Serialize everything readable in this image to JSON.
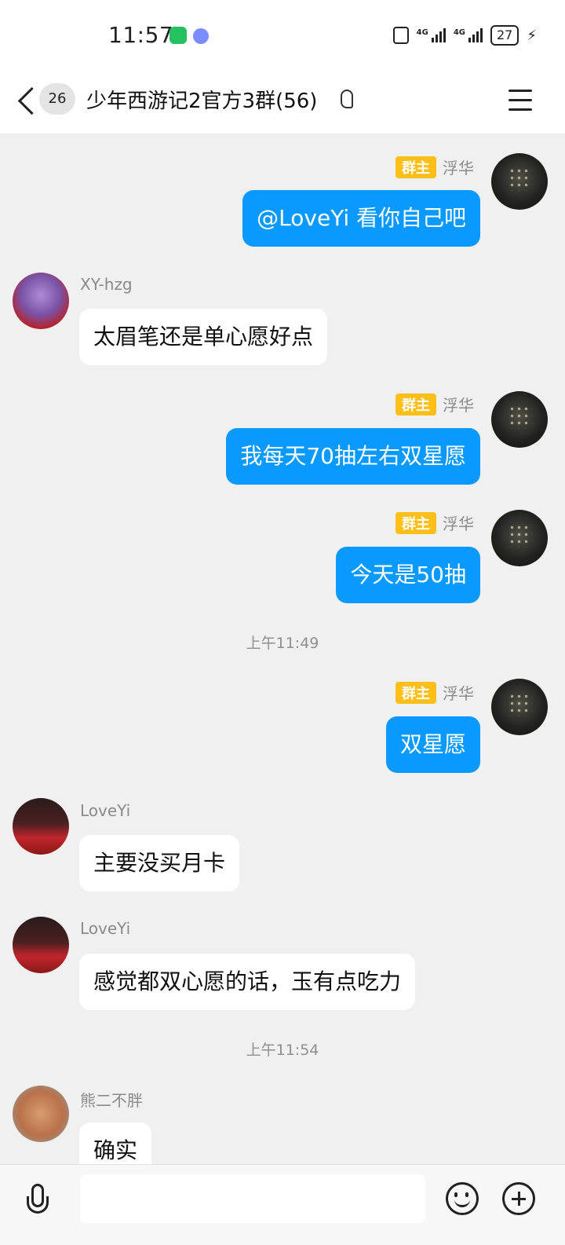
{
  "status_bar": {
    "time": "11:57",
    "network_1": "4G",
    "network_2": "4G",
    "battery": "27"
  },
  "header": {
    "unread_count": "26",
    "title": "少年西游记2官方3群(56)"
  },
  "messages": [
    {
      "sender": "浮华",
      "role": "群主",
      "text": "@LoveYi 看你自己吧",
      "outgoing": true
    },
    {
      "sender": "XY-hzg",
      "role": "",
      "text": "太眉笔还是单心愿好点",
      "outgoing": false
    },
    {
      "sender": "浮华",
      "role": "群主",
      "text": "我每天70抽左右双星愿",
      "outgoing": true
    },
    {
      "sender": "浮华",
      "role": "群主",
      "text": "今天是50抽",
      "outgoing": true
    },
    {
      "sender": "浮华",
      "role": "群主",
      "text": "双星愿",
      "outgoing": true
    },
    {
      "sender": "LoveYi",
      "role": "",
      "text": "主要没买月卡",
      "outgoing": false
    },
    {
      "sender": "LoveYi",
      "role": "",
      "text": "感觉都双心愿的话，玉有点吃力",
      "outgoing": false
    },
    {
      "sender": "熊二不胖",
      "role": "",
      "text": "确实",
      "outgoing": false
    }
  ],
  "timestamps": [
    "上午11:49",
    "上午11:54"
  ],
  "colors": {
    "outgoing_bubble": "#0a99ff",
    "incoming_bubble": "#ffffff",
    "owner_badge": "#fbbf18",
    "chat_background": "#f0f0f0"
  },
  "icons": {
    "back": "chevron-left-icon",
    "listen": "ear-icon",
    "menu": "hamburger-icon",
    "voice": "microphone-icon",
    "emoji": "smiley-icon",
    "more": "plus-circle-icon"
  }
}
